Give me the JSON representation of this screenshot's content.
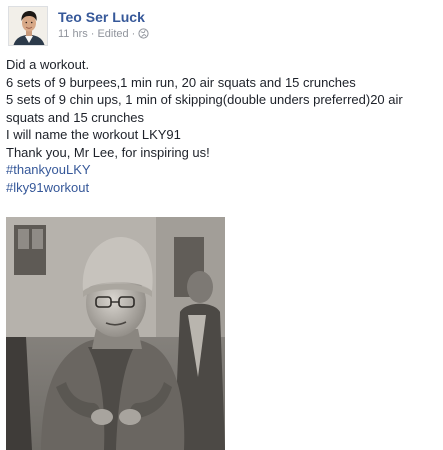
{
  "post": {
    "author_name": "Teo Ser Luck",
    "timestamp": "11 hrs",
    "edited_label": "Edited",
    "privacy_icon": "globe-icon",
    "lines": [
      "Did a workout.",
      "6 sets of 9 burpees,1 min run, 20 air squats and 15 crunches",
      "5 sets of 9 chin ups, 1 min of skipping(double unders preferred)20 air",
      "squats and 15 crunches",
      "I will name the workout LKY91",
      "Thank you, Mr Lee, for inspiring us!"
    ],
    "hashtags": [
      "#thankyouLKY",
      "#lky91workout"
    ]
  },
  "colors": {
    "link": "#365899",
    "text": "#1d2129",
    "meta": "#90949c"
  }
}
